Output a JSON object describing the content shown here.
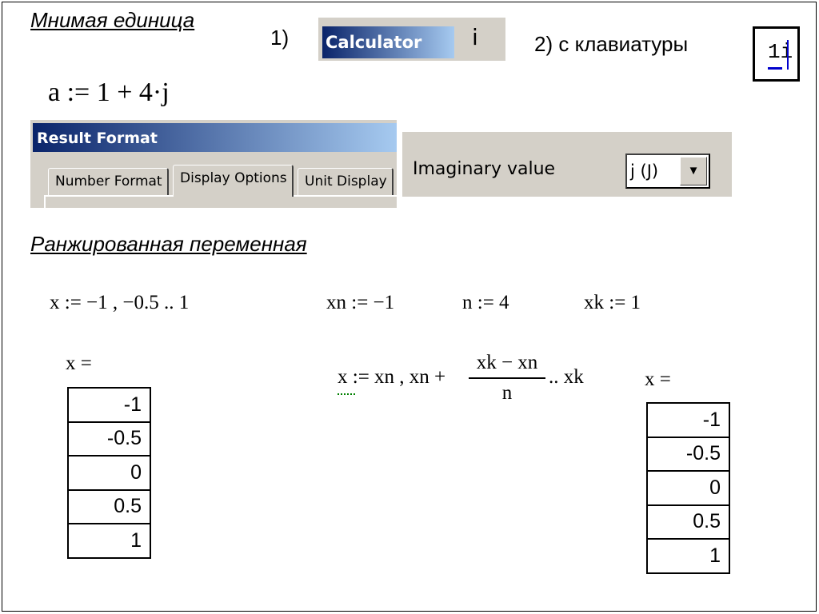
{
  "section1": {
    "title": "Мнимая единица",
    "step1": "1)",
    "calculator": {
      "title": "Calculator",
      "button": "i"
    },
    "step2": "2) с клавиатуры",
    "keyboard_example": "1i",
    "assignment": "a := 1 + 4·j"
  },
  "result_format": {
    "title": "Result Format",
    "tabs": [
      {
        "label": "Number Format",
        "active": false
      },
      {
        "label": "Display Options",
        "active": true
      },
      {
        "label": "Unit Display",
        "active": false
      }
    ]
  },
  "imaginary": {
    "label": "Imaginary value",
    "selected": "j (J)"
  },
  "section2": {
    "title": "Ранжированная переменная",
    "range_def": "x := −1 , −0.5 .. 1",
    "xn_def": "xn := −1",
    "n_def": "n := 4",
    "xk_def": "xk := 1",
    "result_label_left": "x =",
    "table_left": [
      "-1",
      "-0.5",
      "0",
      "0.5",
      "1"
    ],
    "formula": {
      "lhs": "x",
      "assign": ":= xn , xn +",
      "numerator": "xk − xn",
      "denominator": "n",
      "tail": ".. xk"
    },
    "result_label_right": "x =",
    "table_right": [
      "-1",
      "-0.5",
      "0",
      "0.5",
      "1"
    ]
  },
  "colors": {
    "titlebar_start": "#0a246a",
    "titlebar_end": "#a6caf0",
    "dialog_bg": "#d4d0c8",
    "cursor": "#0000cc",
    "warning_squiggle": "#008000"
  }
}
